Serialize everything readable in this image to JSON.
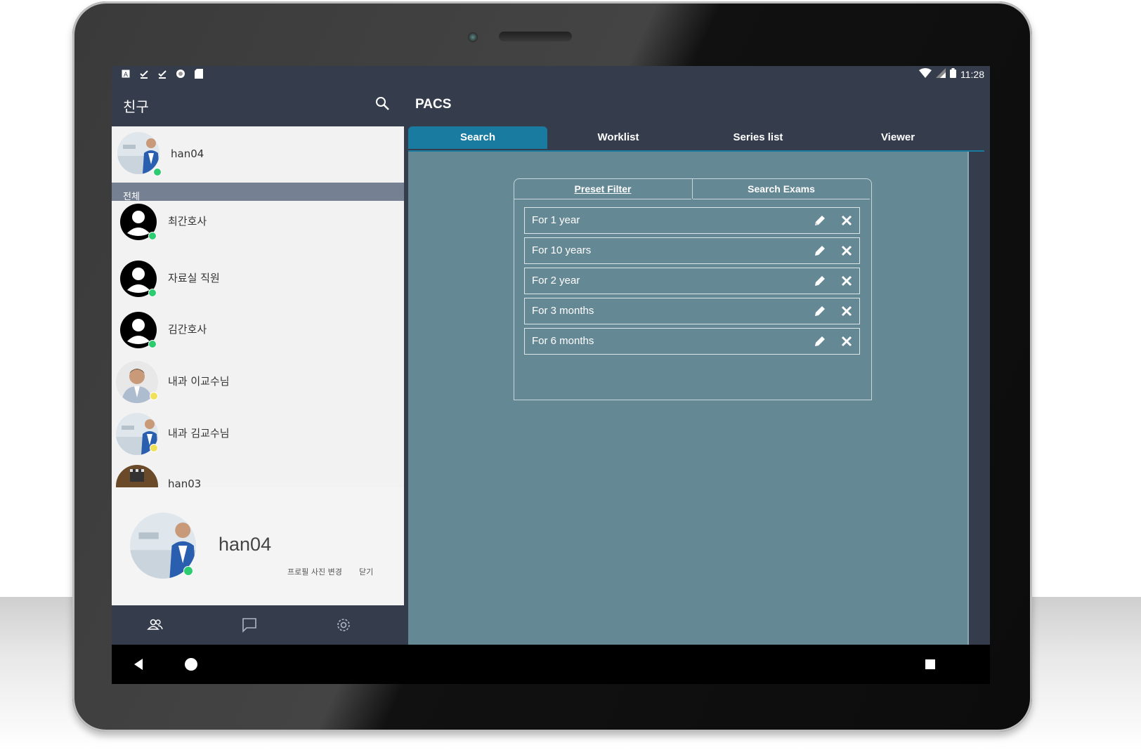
{
  "status_bar": {
    "time": "11:28"
  },
  "left": {
    "title": "친구",
    "me": {
      "name": "han04",
      "status_color": "#2ecc71"
    },
    "section_label": "전체",
    "friends": [
      {
        "name": "최간호사",
        "avatar": "default-person-icon",
        "status_color": "#2ecc71"
      },
      {
        "name": "자료실 직원",
        "avatar": "default-person-icon",
        "status_color": "#2ecc71"
      },
      {
        "name": "김간호사",
        "avatar": "default-person-icon",
        "status_color": "#2ecc71"
      },
      {
        "name": "내과 이교수님",
        "avatar": "photo",
        "status_color": "#f1e05a"
      },
      {
        "name": "내과 김교수님",
        "avatar": "photo",
        "status_color": "#f1e05a"
      },
      {
        "name": "han03",
        "avatar": "photo"
      }
    ],
    "profile": {
      "name": "han04",
      "change_photo_label": "프로필 사진 변경",
      "close_label": "닫기"
    },
    "bottom_tabs": [
      "friends-icon",
      "chat-icon",
      "settings-icon"
    ]
  },
  "main": {
    "title": "PACS",
    "tabs": [
      {
        "label": "Search",
        "active": true
      },
      {
        "label": "Worklist",
        "active": false
      },
      {
        "label": "Series list",
        "active": false
      },
      {
        "label": "Viewer",
        "active": false
      }
    ],
    "filter_tabs": [
      {
        "label": "Preset Filter",
        "active": true
      },
      {
        "label": "Search Exams",
        "active": false
      }
    ],
    "presets": [
      {
        "label": "For 1 year"
      },
      {
        "label": "For 10 years"
      },
      {
        "label": "For 2 year"
      },
      {
        "label": "For 3 months"
      },
      {
        "label": "For 6 months"
      }
    ]
  },
  "colors": {
    "header_bg": "#353d4d",
    "accent": "#1a7ba0",
    "content_bg": "#658895",
    "section_bg": "#758093",
    "online": "#2ecc71",
    "away": "#f1e05a"
  }
}
